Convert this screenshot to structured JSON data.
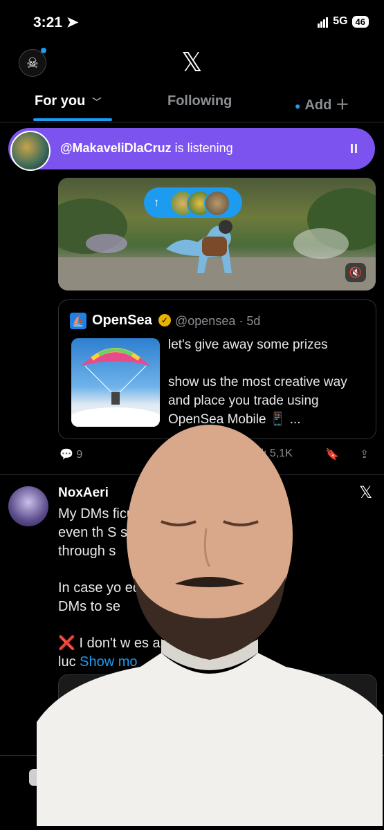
{
  "status_bar": {
    "time": "3:21",
    "network": "5G",
    "battery": "46"
  },
  "header": {
    "logo": "𝕏"
  },
  "tabs": {
    "for_you": "For you",
    "following": "Following",
    "add": "Add"
  },
  "listening": {
    "handle": "@MakaveliDlaCruz",
    "suffix": " is listening",
    "pause": "II"
  },
  "media": {
    "pill_arrow": "↑"
  },
  "quote": {
    "logo": "⛵",
    "name": "OpenSea",
    "badge": "✓",
    "meta": "@opensea · 5d",
    "text": "let's give away some prizes\n\nshow us the most creative way and place you trade using OpenSea Mobile 📱 ..."
  },
  "actions": {
    "replies": "9",
    "views": "5,1K"
  },
  "post2": {
    "name": "NoxAeri",
    "close": "𝕏",
    "p1": "My DMs                         ficult to manage\neven th                         S spots\nthrough                         s",
    "p2": "In case yo                       ed to be in my\nDMs to se",
    "p3_emoji": "❌",
    "p3": " I don't w                       es and pray for\nluc",
    "show_more": " Show mo"
  },
  "colors": {
    "accent": "#1d9bf0",
    "listening_bar": "#7d53f0",
    "background": "#000000"
  }
}
